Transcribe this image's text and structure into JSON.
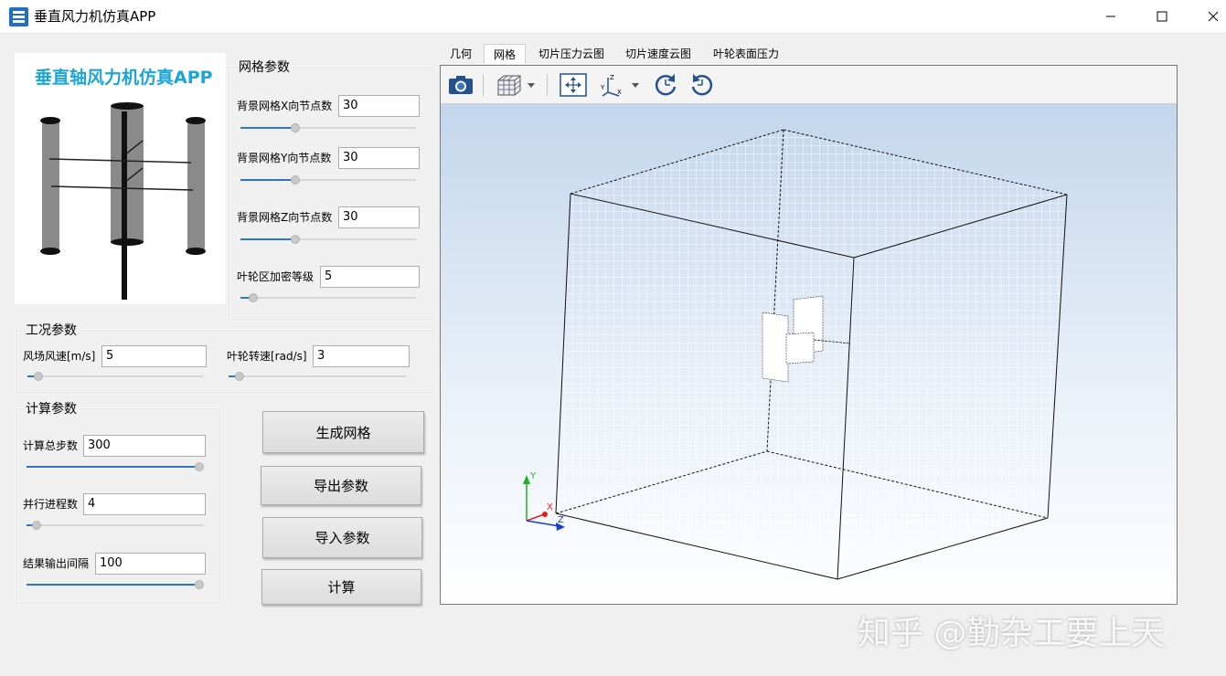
{
  "window": {
    "title": "垂直风力机仿真APP",
    "minimize_glyph": "—",
    "maximize_glyph": "☐",
    "close_glyph": "✕"
  },
  "logo": {
    "title": "垂直轴风力机仿真APP"
  },
  "mesh_params": {
    "title": "网格参数",
    "fields": [
      {
        "label": "背景网格X向节点数",
        "value": "30",
        "slider": 0.3
      },
      {
        "label": "背景网格Y向节点数",
        "value": "30",
        "slider": 0.3
      },
      {
        "label": "背景网格Z向节点数",
        "value": "30",
        "slider": 0.3
      },
      {
        "label": "叶轮区加密等级",
        "value": "5",
        "slider": 0.05
      }
    ]
  },
  "condition_params": {
    "title": "工况参数",
    "fields": [
      {
        "label": "风场风速[m/s]",
        "value": "5",
        "slider": 0.04
      },
      {
        "label": "叶轮转速[rad/s]",
        "value": "3",
        "slider": 0.04
      }
    ]
  },
  "calc_params": {
    "title": "计算参数",
    "fields": [
      {
        "label": "计算总步数",
        "value": "300",
        "slider": 1.0
      },
      {
        "label": "并行进程数",
        "value": "4",
        "slider": 0.03
      },
      {
        "label": "结果输出间隔",
        "value": "100",
        "slider": 1.0
      }
    ]
  },
  "actions": {
    "generate_mesh": "生成网格",
    "export_params": "导出参数",
    "import_params": "导入参数",
    "compute": "计算"
  },
  "tabs": [
    {
      "label": "几何",
      "active": false
    },
    {
      "label": "网格",
      "active": true
    },
    {
      "label": "切片压力云图",
      "active": false
    },
    {
      "label": "切片速度云图",
      "active": false
    },
    {
      "label": "叶轮表面压力",
      "active": false
    }
  ],
  "toolbar_icons": [
    "camera-icon",
    "mesh-display-icon",
    "fit-view-icon",
    "axes-orientation-icon",
    "rotate-cw-icon",
    "rotate-ccw-icon"
  ],
  "axes": {
    "x": "X",
    "y": "Y",
    "z": "Z"
  },
  "watermark": "知乎 @勤杂工要上天",
  "colors": {
    "accent": "#2f75c7",
    "logo_text": "#1ba6d9",
    "axis_x": "#e02020",
    "axis_y": "#20b020",
    "axis_z": "#1a3cd0"
  }
}
